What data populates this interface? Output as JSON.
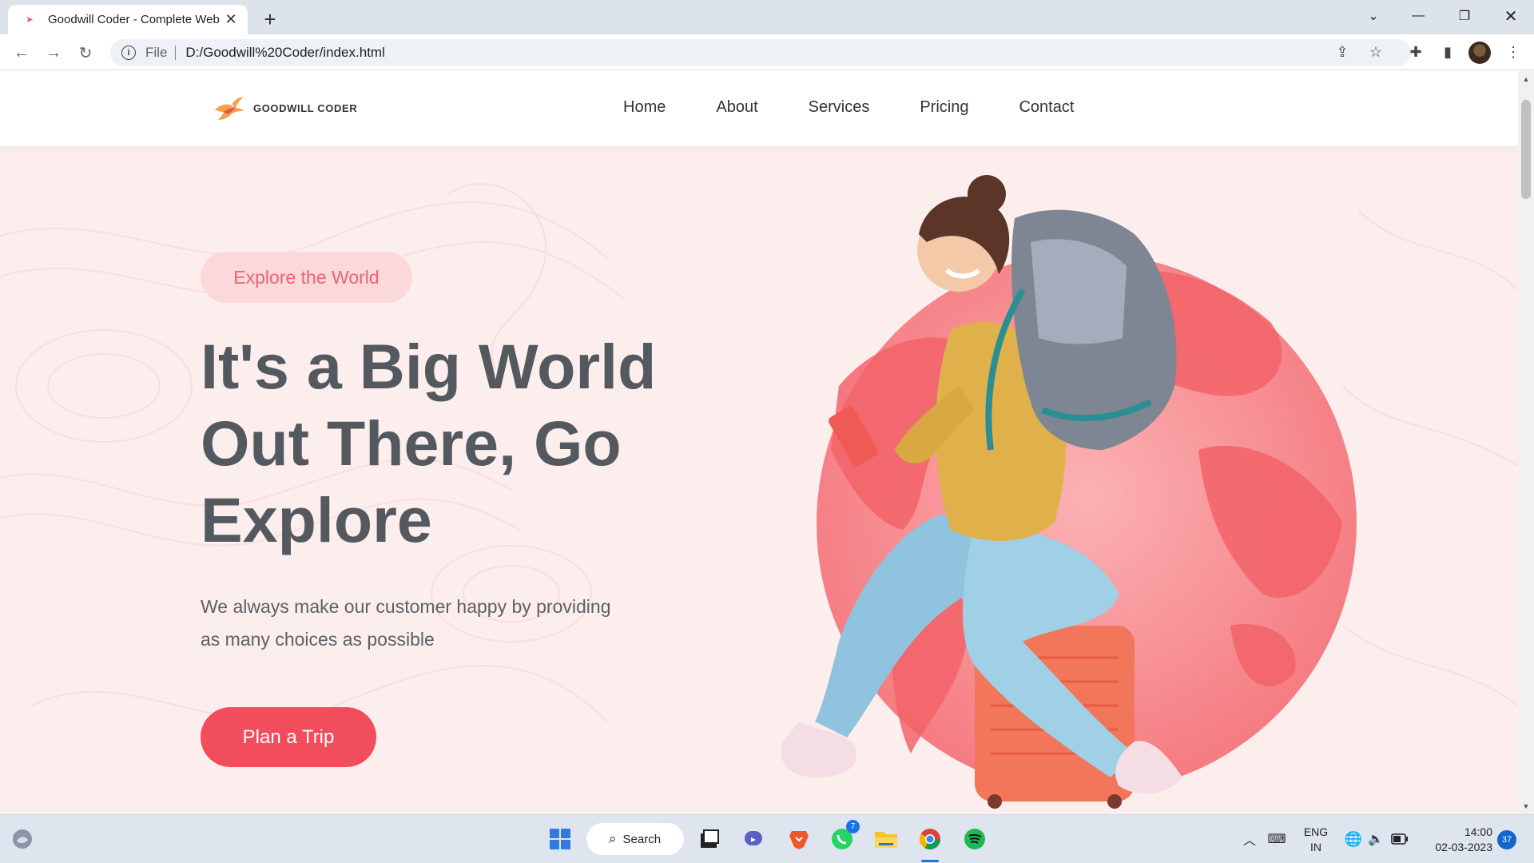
{
  "browser": {
    "tab_title": "Goodwill Coder - Complete Web",
    "scheme_label": "File",
    "url": "D:/Goodwill%20Coder/index.html"
  },
  "site": {
    "brand": "GOODWILL CODER",
    "nav": [
      {
        "label": "Home"
      },
      {
        "label": "About"
      },
      {
        "label": "Services"
      },
      {
        "label": "Pricing"
      },
      {
        "label": "Contact"
      }
    ]
  },
  "hero": {
    "badge": "Explore the World",
    "title_lines": [
      "It's a Big World",
      "Out There, Go",
      "Explore"
    ],
    "subtitle_lines": [
      "We always make our customer happy by providing",
      "as many choices as possible"
    ],
    "cta_label": "Plan a Trip"
  },
  "taskbar": {
    "search_label": "Search",
    "whatsapp_badge": "7",
    "lang_top": "ENG",
    "lang_bottom": "IN",
    "time": "14:00",
    "date": "02-03-2023",
    "notifications": "37"
  },
  "colors": {
    "accent": "#f24d5c",
    "hero_bg": "#fdeeee",
    "pill_bg": "#fbd9db",
    "heading": "#54585f"
  }
}
